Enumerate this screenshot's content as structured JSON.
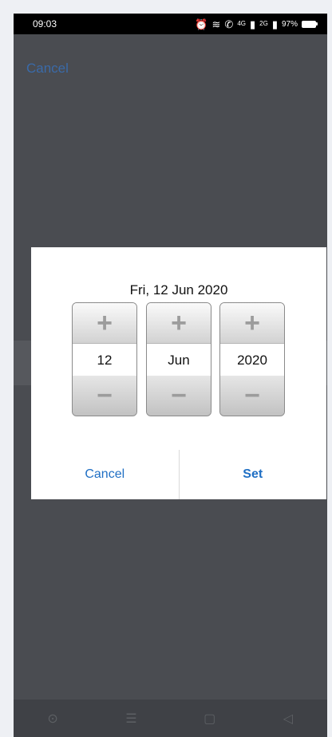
{
  "status_bar": {
    "time": "09:03",
    "network_4g": "4G",
    "network_2g": "2G",
    "battery": "97%"
  },
  "background": {
    "cancel_label": "Cancel"
  },
  "dialog": {
    "title": "Fri, 12 Jun 2020",
    "increment_symbol": "+",
    "decrement_symbol": "−",
    "day": "12",
    "month": "Jun",
    "year": "2020",
    "cancel_label": "Cancel",
    "set_label": "Set"
  },
  "nav": {
    "assistant_icon": "⊙",
    "menu_icon": "☰",
    "home_icon": "▢",
    "back_icon": "◁"
  }
}
